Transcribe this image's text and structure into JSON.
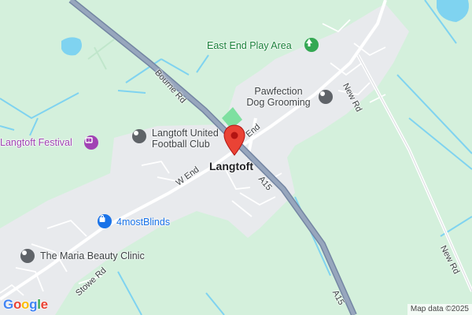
{
  "map": {
    "town_label": "Langtoft",
    "roads": {
      "bourne_rd": "Bourne Rd",
      "a15_north": "A15",
      "a15_south": "A15",
      "w_end": "W End",
      "end": "End",
      "new_rd_north": "New Rd",
      "new_rd_south": "New Rd",
      "stowe_rd": "Stowe Rd"
    },
    "pois": {
      "east_end_play_area": "East End Play Area",
      "pawfection": [
        "Pawfection",
        "Dog Grooming"
      ],
      "langtoft_united": [
        "Langtoft United",
        "Football Club"
      ],
      "langtoft_festival": "Langtoft Festival",
      "four_most_blinds": "4mostBlinds",
      "maria_beauty_clinic": "The Maria Beauty Clinic"
    },
    "icons": {
      "park": "tree-icon",
      "grey_poi": "place-icon",
      "festival": "ticket-icon",
      "blinds": "shopping-bag-icon",
      "selected": "red-marker-icon"
    },
    "colors": {
      "land": "#d4f0dc",
      "urban": "#e8eaed",
      "water": "#7fd3f0",
      "major_road": "#8c9bb5",
      "park_green": "#34a853",
      "poi_grey": "#5f6368",
      "festival_purple": "#a142b4",
      "shop_blue": "#1a73e8",
      "marker_red": "#ea4335"
    }
  },
  "branding": {
    "logo": "Google"
  },
  "attribution": "Map data ©2025"
}
